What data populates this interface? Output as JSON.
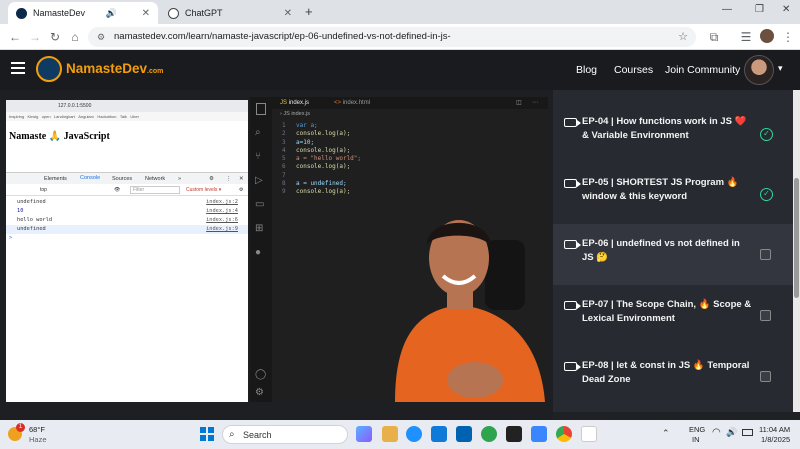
{
  "browser": {
    "tabs": [
      {
        "title": "NamasteDev",
        "active": true
      },
      {
        "title": "ChatGPT",
        "active": false
      }
    ],
    "url": "namastedev.com/learn/namaste-javascript/ep-06-undefined-vs-not-defined-in-js-"
  },
  "nav": {
    "logo": "NamasteDev",
    "logo_suffix": ".com",
    "links": [
      "Blog",
      "Courses",
      "Join Community"
    ]
  },
  "video": {
    "inner_browser": {
      "url": "127.0.0.1:5500",
      "bookmarks": [
        "Inspiring",
        "Kirwig",
        "open",
        "Landingkart",
        "Angularx",
        "Hackathon",
        "Talk",
        "Uber"
      ],
      "page_heading": "Namaste 🙏 JavaScript",
      "devtools_tabs": [
        "Elements",
        "Console",
        "Sources",
        "Network",
        "»"
      ],
      "context": "top",
      "filter_placeholder": "Filter",
      "levels": "Custom levels ▾",
      "console": [
        {
          "text": "undefined",
          "source": "index.js:2"
        },
        {
          "text": "10",
          "source": "index.js:4"
        },
        {
          "text": "hello world",
          "source": "index.js:6"
        },
        {
          "text": "undefined",
          "source": "index.js:9"
        }
      ],
      "prompt": ">"
    },
    "editor": {
      "tabs": [
        "index.js",
        "index.html"
      ],
      "breadcrumb": "JS index.js",
      "lines": [
        {
          "n": "1",
          "code": "var a;"
        },
        {
          "n": "2",
          "code": "console.log(a);"
        },
        {
          "n": "3",
          "code": "a=10;"
        },
        {
          "n": "4",
          "code": "console.log(a);"
        },
        {
          "n": "5",
          "code": "a = \"hello world\";"
        },
        {
          "n": "6",
          "code": "console.log(a);"
        },
        {
          "n": "7",
          "code": ""
        },
        {
          "n": "8",
          "code": "a = undefined;"
        },
        {
          "n": "9",
          "code": "console.log(a);"
        }
      ]
    }
  },
  "episodes": [
    {
      "title": "EP-04 | How functions work in JS ❤️ & Variable Environment",
      "done": true
    },
    {
      "title": "EP-05 | SHORTEST JS Program 🔥 window & this keyword",
      "done": true
    },
    {
      "title": "EP-06 | undefined vs not defined in JS 🤔",
      "done": false,
      "active": true
    },
    {
      "title": "EP-07 | The Scope Chain, 🔥 Scope & Lexical Environment",
      "done": false
    },
    {
      "title": "EP-08 | let & const in JS 🔥 Temporal Dead Zone",
      "done": false
    }
  ],
  "taskbar": {
    "weather_temp": "68°F",
    "weather_desc": "Haze",
    "weather_badge": "1",
    "search": "Search",
    "lang": "ENG",
    "region": "IN",
    "time": "11:04 AM",
    "date": "1/8/2025"
  },
  "colors": {
    "accent": "#f59e0b",
    "done": "#34d399",
    "sidebar": "#272a31"
  }
}
